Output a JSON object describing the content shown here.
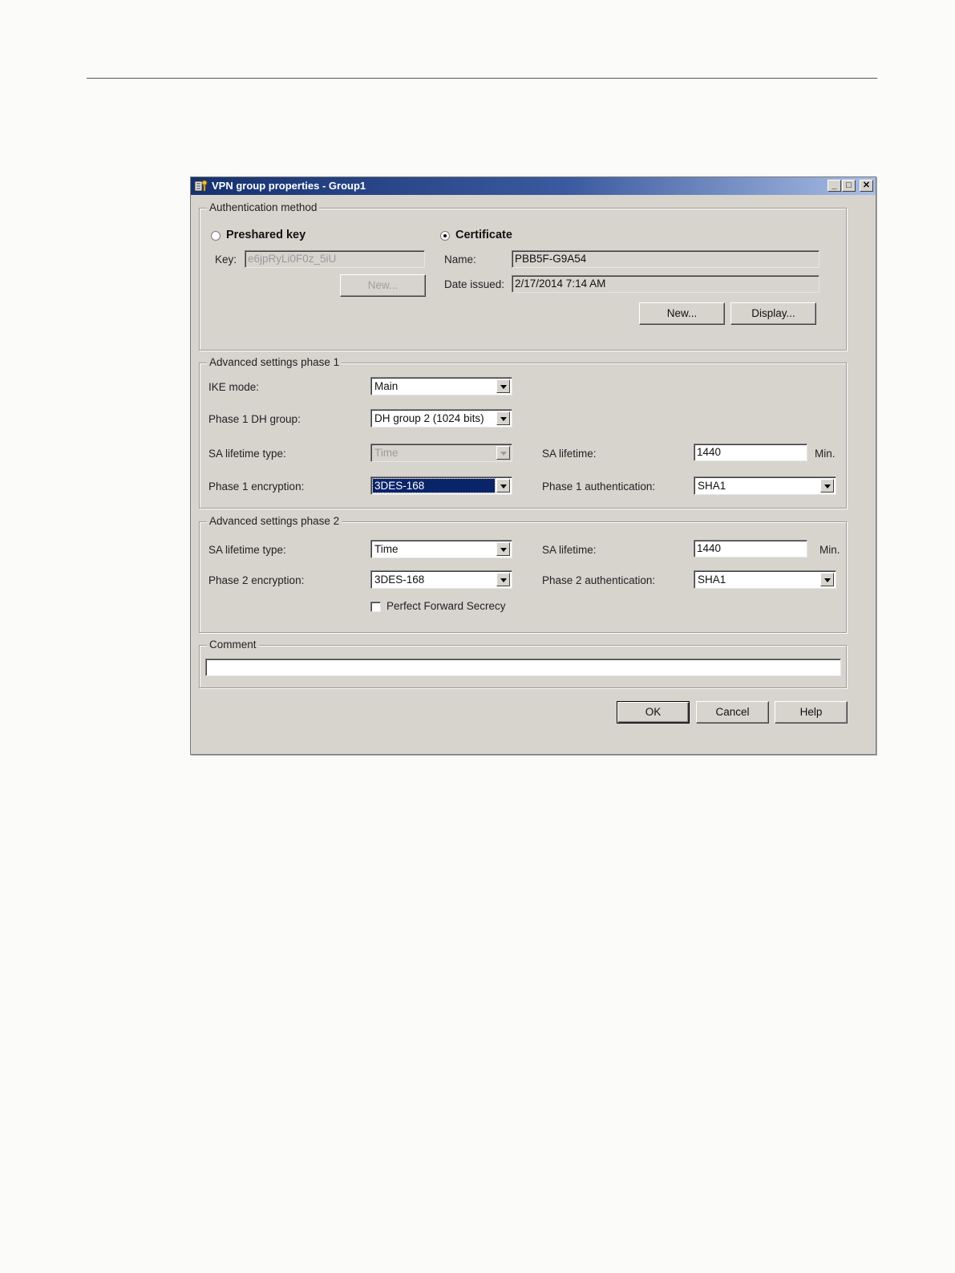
{
  "window": {
    "title": "VPN group properties -  Group1",
    "icon": "vpn-key-icon"
  },
  "auth": {
    "legend": "Authentication method",
    "preshared_label": "Preshared key",
    "preshared_selected": false,
    "key_label": "Key:",
    "key_value": "e6jpRyLi0F0z_5iU",
    "key_new_button": "New...",
    "certificate_label": "Certificate",
    "certificate_selected": true,
    "name_label": "Name:",
    "name_value": "PBB5F-G9A54",
    "date_label": "Date issued:",
    "date_value": "2/17/2014 7:14 AM",
    "cert_new_button": "New...",
    "display_button": "Display..."
  },
  "phase1": {
    "legend": "Advanced settings phase 1",
    "ike_mode_label": "IKE mode:",
    "ike_mode_value": "Main",
    "dh_group_label": "Phase 1 DH group:",
    "dh_group_value": "DH group 2 (1024 bits)",
    "sa_type_label": "SA lifetime type:",
    "sa_type_value": "Time",
    "sa_lifetime_label": "SA lifetime:",
    "sa_lifetime_value": "1440",
    "sa_unit": "Min.",
    "encryption_label": "Phase 1 encryption:",
    "encryption_value": "3DES-168",
    "auth_label": "Phase 1 authentication:",
    "auth_value": "SHA1"
  },
  "phase2": {
    "legend": "Advanced settings phase 2",
    "sa_type_label": "SA lifetime type:",
    "sa_type_value": "Time",
    "sa_lifetime_label": "SA lifetime:",
    "sa_lifetime_value": "1440",
    "sa_unit": "Min.",
    "encryption_label": "Phase 2 encryption:",
    "encryption_value": "3DES-168",
    "auth_label": "Phase 2 authentication:",
    "auth_value": "SHA1",
    "pfs_label": "Perfect Forward Secrecy",
    "pfs_checked": false
  },
  "comment": {
    "legend": "Comment",
    "value": ""
  },
  "buttons": {
    "ok": "OK",
    "cancel": "Cancel",
    "help": "Help"
  }
}
